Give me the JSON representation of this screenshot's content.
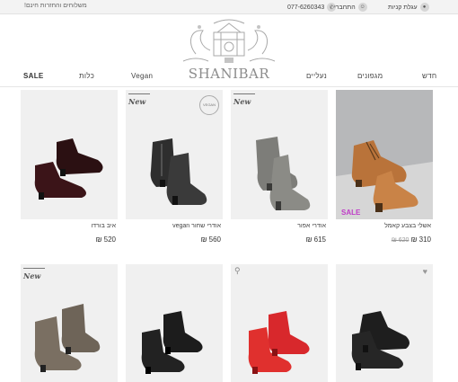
{
  "topbar": {
    "promo": "משלוחים והחזרות חינם!",
    "cart_label": "עגלת קניות",
    "cart_icon": "lock-icon",
    "login_label": "התחברי",
    "login_icon": "person-icon",
    "phone": "077-6260343",
    "phone_icon": "phone-icon"
  },
  "brand": {
    "name": "SHANIBAR"
  },
  "nav": {
    "new": "חדש",
    "handbags": "מגפונים",
    "shoes": "נעליים",
    "vegan": "Vegan",
    "brides": "כלות",
    "sale": "SALE"
  },
  "colors": {
    "sale_badge": "#c03cc8"
  },
  "products_row1": [
    {
      "name": "אשלי בצבע קאמל",
      "price": "310 ₪",
      "old_price": "620 ₪",
      "badge": "SALE"
    },
    {
      "name": "אודרי אפור",
      "price": "615 ₪",
      "badge": "New"
    },
    {
      "name": "אודרי שחור vegan",
      "price": "560 ₪",
      "badge": "New",
      "seal": "VEGAN"
    },
    {
      "name": "איב בורדו",
      "price": "520 ₪"
    }
  ],
  "products_row2": [
    {
      "badge": "New"
    },
    {
      "badge": ""
    },
    {
      "badge": ""
    },
    {
      "badge": ""
    }
  ]
}
